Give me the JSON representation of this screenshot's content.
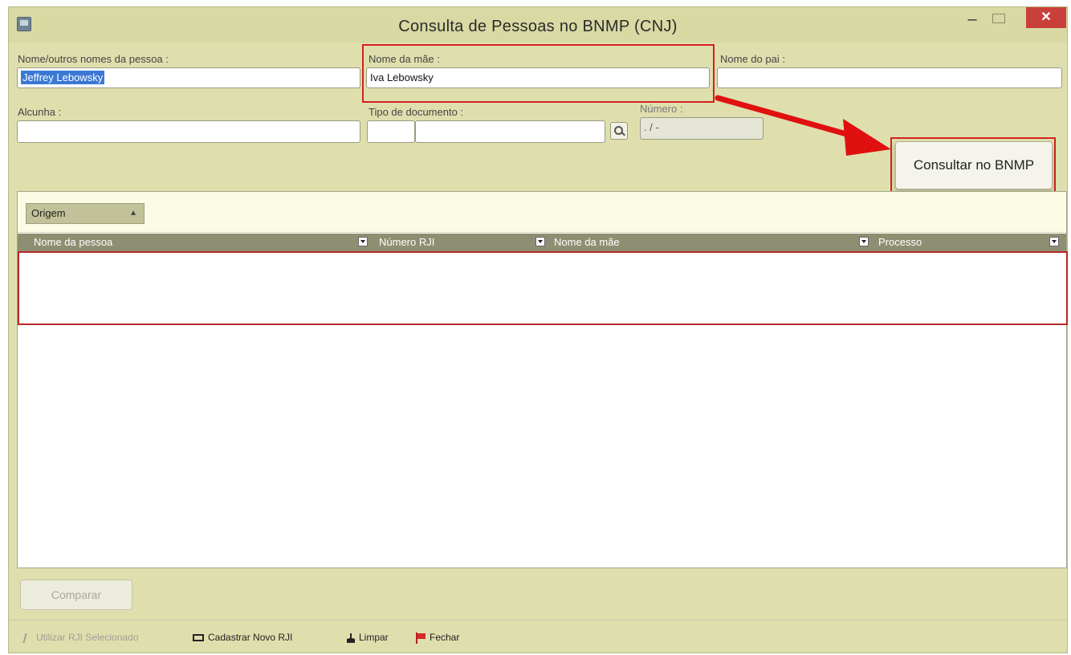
{
  "window": {
    "title": "Consulta de Pessoas no BNMP (CNJ)"
  },
  "form": {
    "nome_label": "Nome/outros nomes da pessoa :",
    "nome_value": "Jeffrey Lebowsky",
    "mae_label": "Nome da mãe :",
    "mae_value": "Iva Lebowsky",
    "pai_label": "Nome do pai :",
    "pai_value": "",
    "alcunha_label": "Alcunha :",
    "alcunha_value": "",
    "tipo_doc_label": "Tipo de documento :",
    "tipo_doc_code": "",
    "tipo_doc_value": "",
    "numero_label": "Número :",
    "numero_value": "  .  /  -"
  },
  "actions": {
    "consultar_label": "Consultar no BNMP"
  },
  "grid": {
    "group_by": "Origem",
    "columns": [
      "Nome da pessoa",
      "Número RJI",
      "Nome da mãe",
      "Processo"
    ],
    "rows": []
  },
  "comparar_label": "Comparar",
  "bottom_bar": {
    "utilizar": "Utilizar RJI Selecionado",
    "cadastrar": "Cadastrar Novo RJI",
    "limpar": "Limpar",
    "fechar": "Fechar"
  },
  "colors": {
    "highlight": "#d42020",
    "arrow": "#e01010",
    "header": "#8e8e72",
    "window_bg": "#dfdfae"
  }
}
